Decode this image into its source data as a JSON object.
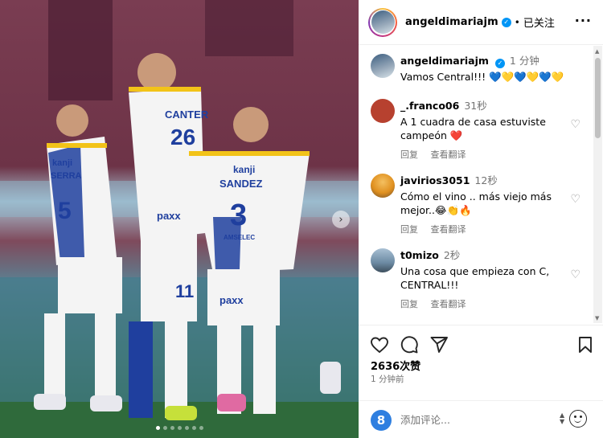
{
  "post": {
    "username": "angeldimariajm",
    "follow_status": "已关注",
    "more_label": "···"
  },
  "photo": {
    "jersey_texts": [
      "CANTER",
      "SANDEZ",
      "kanji",
      "kanji",
      "SERRA",
      "paxx",
      "paxx",
      "AMSELEC"
    ],
    "jersey_numbers": [
      "3",
      "5",
      "26",
      "11"
    ]
  },
  "caption": {
    "username": "angeldimariajm",
    "time": "1 分钟",
    "text": "Vamos Central!!! 💙💛💙💛💙💛"
  },
  "comments": [
    {
      "username": "_.franco06",
      "time": "31秒",
      "text": "A 1 cuadra de casa estuviste campeón ❤️",
      "reply_label": "回复",
      "translate_label": "查看翻译",
      "avatar_color": "#b7412f"
    },
    {
      "username": "javirios3051",
      "time": "12秒",
      "text": "Cómo el vino .. más viejo más mejor..😂👏🔥",
      "reply_label": "回复",
      "translate_label": "查看翻译",
      "avatar_color": "#e0901f"
    },
    {
      "username": "t0mizo",
      "time": "2秒",
      "text": "Una cosa que empieza con C, CENTRAL!!!",
      "reply_label": "回复",
      "translate_label": "查看翻译",
      "avatar_color": "#6c8aa3"
    }
  ],
  "stats": {
    "likes": "2636次赞",
    "time_ago": "1 分钟前"
  },
  "comment_box": {
    "placeholder": "添加评论...",
    "avatar_letter": "8"
  },
  "colors": {
    "accent_blue": "#0095f6",
    "muted_text": "#737373"
  },
  "icons": [
    "verified-badge-icon",
    "heart-icon",
    "comment-icon",
    "share-icon",
    "bookmark-icon",
    "emoji-icon",
    "chevron-right-icon"
  ]
}
